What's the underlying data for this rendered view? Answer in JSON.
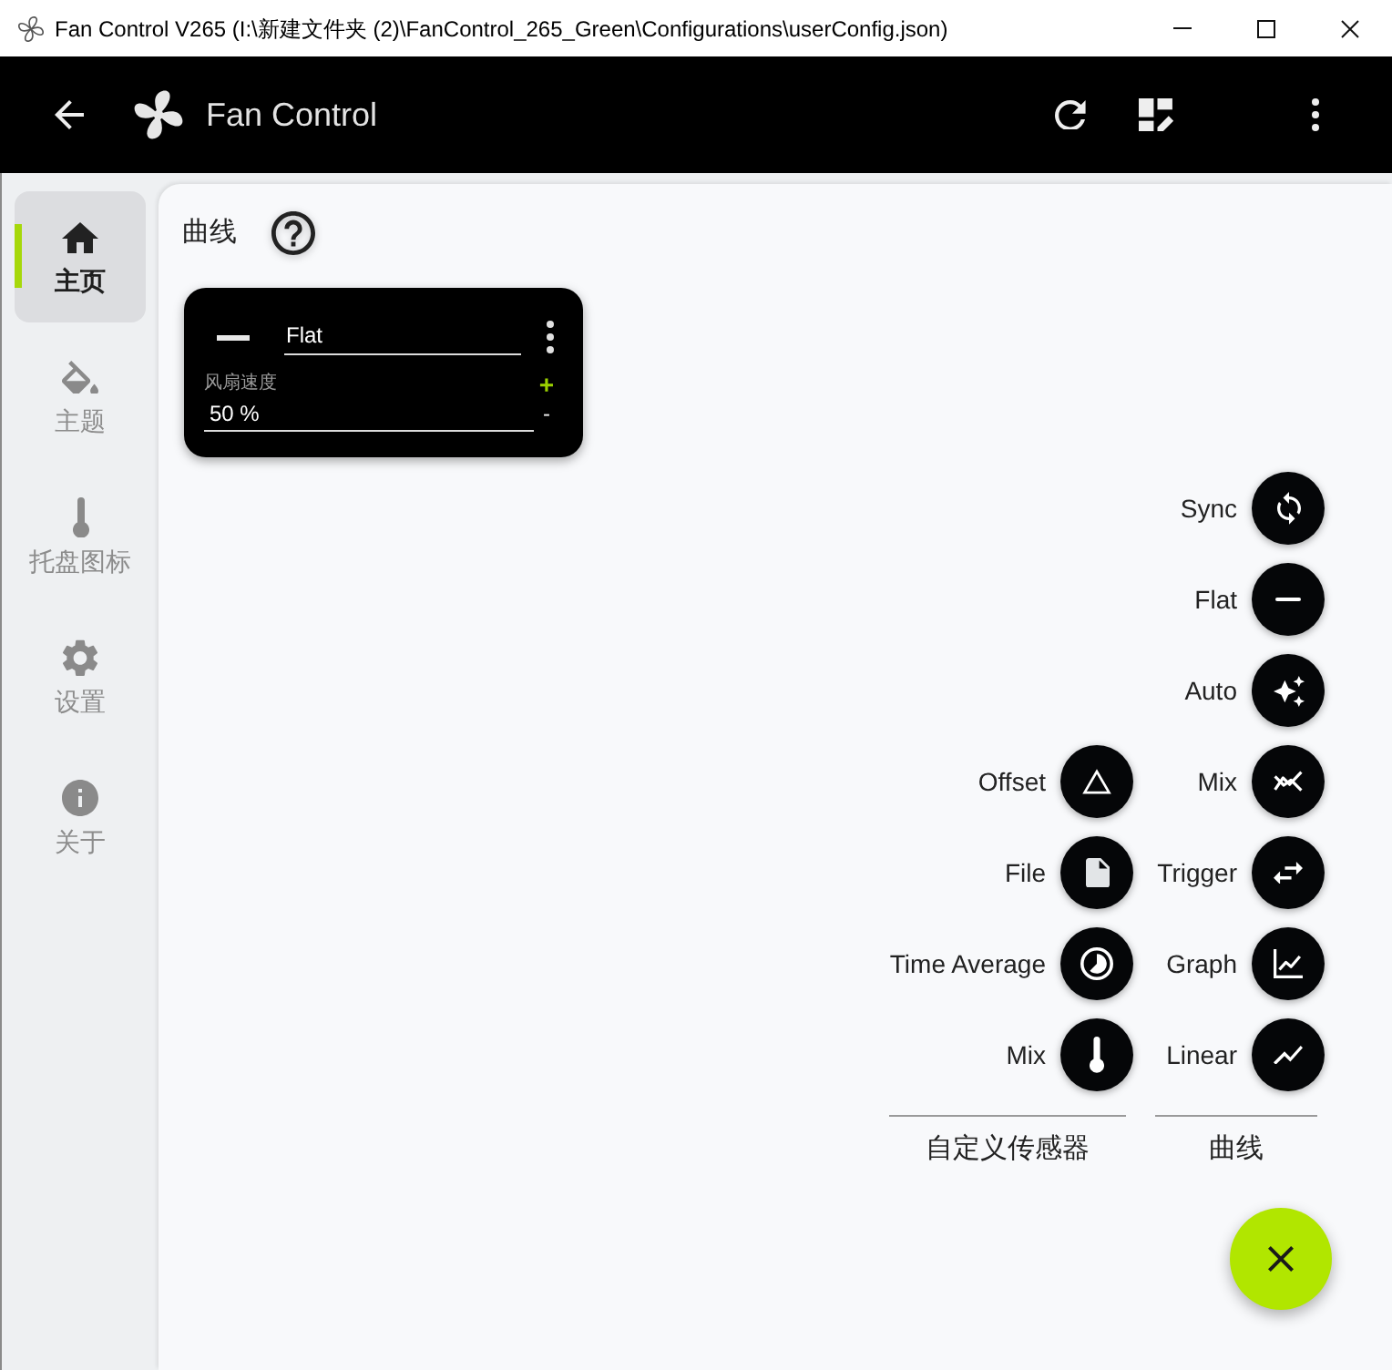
{
  "window": {
    "title": "Fan Control V265 (I:\\新建文件夹 (2)\\FanControl_265_Green\\Configurations\\userConfig.json)"
  },
  "app_bar": {
    "title": "Fan Control"
  },
  "sidebar": {
    "items": [
      {
        "label": "主页",
        "kind": "home",
        "selected": true
      },
      {
        "label": "主题",
        "kind": "theme",
        "selected": false
      },
      {
        "label": "托盘图标",
        "kind": "tray",
        "selected": false
      },
      {
        "label": "设置",
        "kind": "settings",
        "selected": false
      },
      {
        "label": "关于",
        "kind": "about",
        "selected": false
      }
    ]
  },
  "content": {
    "heading": "曲线",
    "cards": [
      {
        "kind": "flat",
        "name": "Flat",
        "field_label": "风扇速度",
        "value": "50 %",
        "increment": "+",
        "decrement": "-"
      }
    ]
  },
  "speed_dial": {
    "groups": [
      {
        "caption": "自定义传感器",
        "items": [
          {
            "label": "Offset",
            "kind": "offset"
          },
          {
            "label": "File",
            "kind": "file"
          },
          {
            "label": "Time Average",
            "kind": "timeaverage"
          },
          {
            "label": "Mix",
            "kind": "sensor"
          }
        ]
      },
      {
        "caption": "曲线",
        "items": [
          {
            "label": "Sync",
            "kind": "sync"
          },
          {
            "label": "Flat",
            "kind": "flat"
          },
          {
            "label": "Auto",
            "kind": "auto"
          },
          {
            "label": "Mix",
            "kind": "mix"
          },
          {
            "label": "Trigger",
            "kind": "trigger"
          },
          {
            "label": "Graph",
            "kind": "graph"
          },
          {
            "label": "Linear",
            "kind": "linear"
          }
        ]
      }
    ]
  }
}
